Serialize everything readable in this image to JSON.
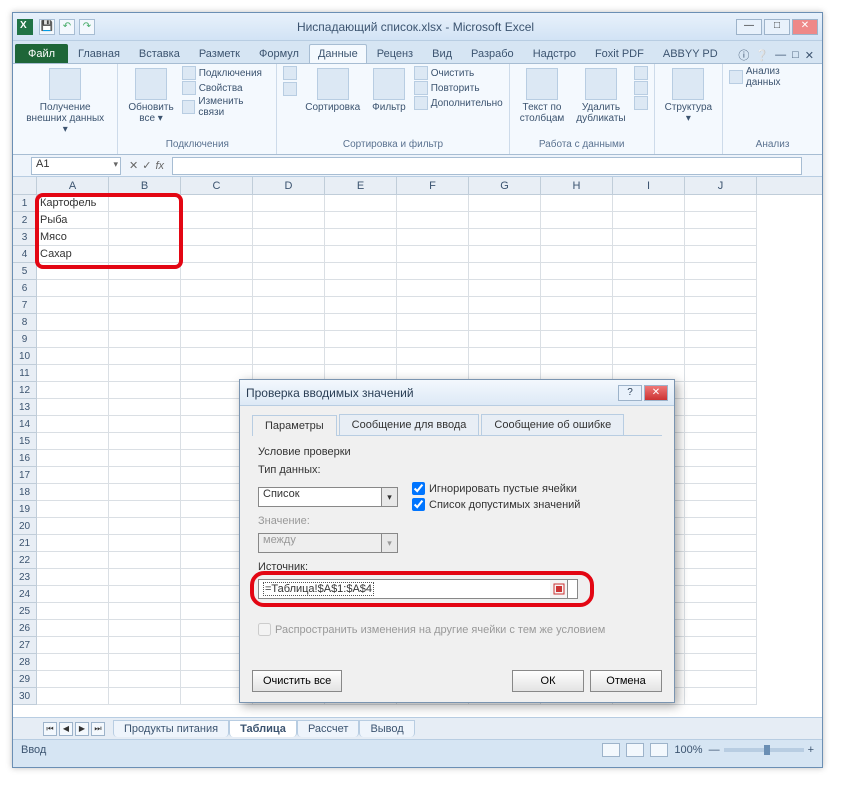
{
  "title": "Ниспадающий список.xlsx - Microsoft Excel",
  "qat": [
    "💾",
    "↶",
    "↷"
  ],
  "wincontrols": {
    "min": "—",
    "max": "□",
    "close": "✕"
  },
  "tabs": [
    "Файл",
    "Главная",
    "Вставка",
    "Разметк",
    "Формул",
    "Данные",
    "Реценз",
    "Вид",
    "Разрабо",
    "Надстро",
    "Foxit PDF",
    "ABBYY PD"
  ],
  "activeTab": 5,
  "ribbonRight": [
    "ⓘ",
    "❔",
    "—",
    "□",
    "✕"
  ],
  "ribbon": {
    "g1": {
      "btn": "Получение\nвнешних данных ▾"
    },
    "g2": {
      "btn": "Обновить\nвсе ▾",
      "items": [
        "Подключения",
        "Свойства",
        "Изменить связи"
      ],
      "label": "Подключения"
    },
    "g3": {
      "sort": "А\nЯ",
      "sortBtn": "Сортировка",
      "filterBtn": "Фильтр",
      "items": [
        "Очистить",
        "Повторить",
        "Дополнительно"
      ],
      "label": "Сортировка и фильтр"
    },
    "g4": {
      "btn1": "Текст по\nстолбцам",
      "btn2": "Удалить\nдубликаты",
      "label": "Работа с данными"
    },
    "g5": {
      "btn": "Структура\n▾"
    },
    "g6": {
      "btn": "Анализ данных",
      "label": "Анализ"
    }
  },
  "namebox": "A1",
  "fx": "fx",
  "columns": [
    "A",
    "B",
    "C",
    "D",
    "E",
    "F",
    "G",
    "H",
    "I",
    "J"
  ],
  "rows": 30,
  "cells": {
    "1": "Картофель",
    "2": "Рыба",
    "3": "Мясо",
    "4": "Сахар"
  },
  "sheets": [
    "Продукты питания",
    "Таблица",
    "Рассчет",
    "Вывод"
  ],
  "activeSheet": 1,
  "status": {
    "left": "Ввод",
    "zoom": "100%",
    "plus": "+",
    "minus": "—"
  },
  "dialog": {
    "title": "Проверка вводимых значений",
    "help": "?",
    "close": "✕",
    "tabs": [
      "Параметры",
      "Сообщение для ввода",
      "Сообщение об ошибке"
    ],
    "activeTab": 0,
    "section": "Условие проверки",
    "typeLabel": "Тип данных:",
    "typeValue": "Список",
    "chk1": "Игнорировать пустые ячейки",
    "chk2": "Список допустимых значений",
    "valueLabel": "Значение:",
    "valueValue": "между",
    "sourceLabel": "Источник:",
    "sourceValue": "=Таблица!$A$1:$A$4",
    "propagate": "Распространить изменения на другие ячейки с тем же условием",
    "clear": "Очистить все",
    "ok": "ОК",
    "cancel": "Отмена"
  }
}
